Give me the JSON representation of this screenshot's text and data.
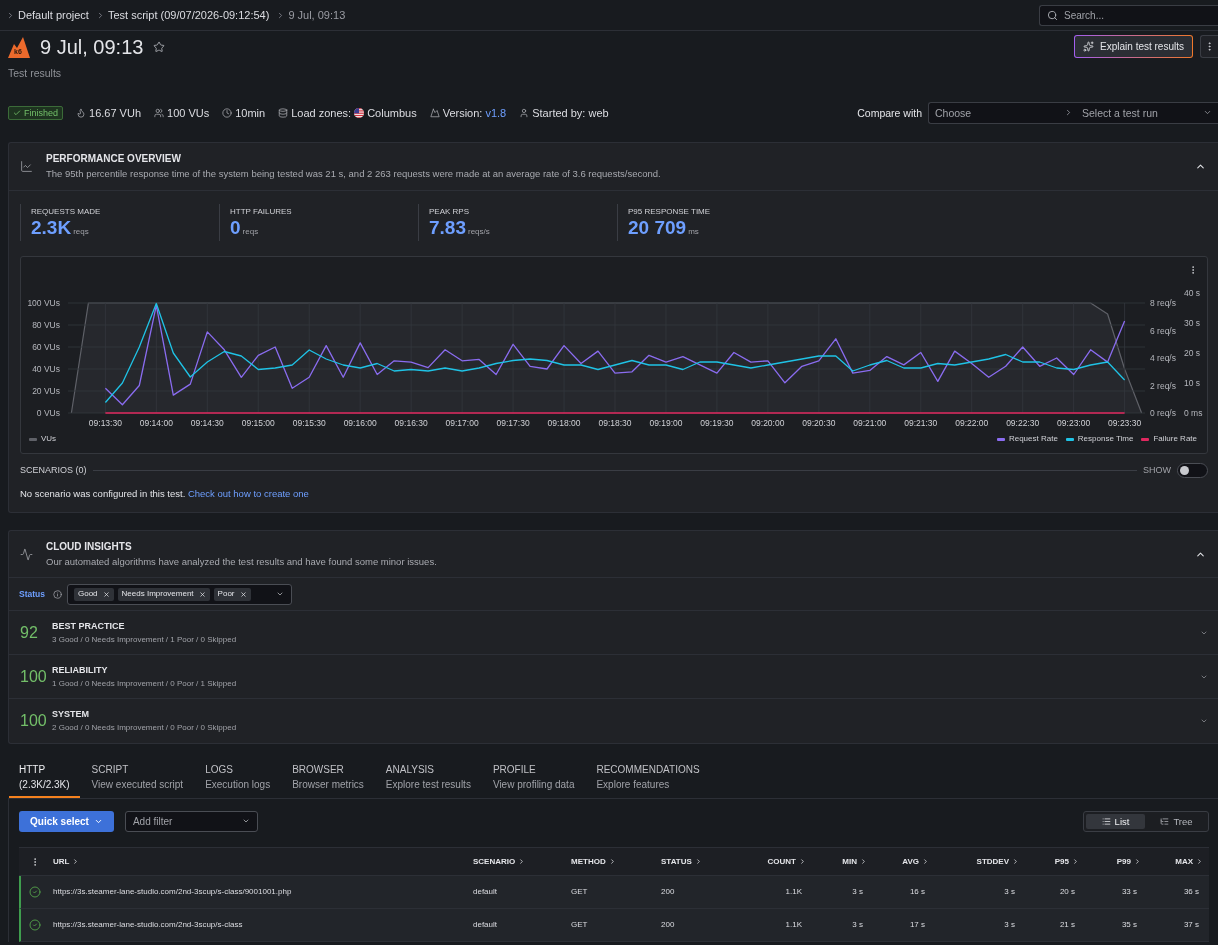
{
  "breadcrumb": [
    {
      "label": "Default project",
      "current": false
    },
    {
      "label": "Test script (09/07/2026-09:12:54)",
      "current": false
    },
    {
      "label": "9 Jul, 09:13",
      "current": true
    }
  ],
  "search": {
    "placeholder": "Search..."
  },
  "header": {
    "logo": "k6",
    "title": "9 Jul, 09:13",
    "starred": false,
    "subtitle": "Test results",
    "explain_button": "Explain test results"
  },
  "run_info": {
    "status": "Finished",
    "items": [
      {
        "kind": "vuh",
        "value": "16.67 VUh"
      },
      {
        "kind": "vus",
        "value": "100 VUs"
      },
      {
        "kind": "duration",
        "value": "10min"
      },
      {
        "kind": "zones",
        "label": "Load zones:",
        "value": "Columbus"
      },
      {
        "kind": "version",
        "label": "Version:",
        "value": "v1.8"
      },
      {
        "kind": "user",
        "value": "Started by: web"
      }
    ]
  },
  "compare": {
    "label": "Compare with",
    "project_placeholder": "Choose",
    "run_placeholder": "Select a test run"
  },
  "performance": {
    "title": "PERFORMANCE OVERVIEW",
    "description": "The 95th percentile response time of the system being tested was 21 s, and 2 263 requests were made at an average rate of 3.6 requests/second.",
    "expanded": true,
    "stats": [
      {
        "label": "REQUESTS MADE",
        "value": "2.3K",
        "unit": "reqs"
      },
      {
        "label": "HTTP FAILURES",
        "value": "0",
        "unit": "reqs"
      },
      {
        "label": "PEAK RPS",
        "value": "7.83",
        "unit": "reqs/s"
      },
      {
        "label": "P95 RESPONSE TIME",
        "value": "20 709",
        "unit": "ms"
      }
    ],
    "chart_data": {
      "type": "line",
      "grid": true,
      "legend": true,
      "categories": [
        null,
        null,
        "09:13:30",
        null,
        null,
        "09:14:00",
        null,
        null,
        "09:14:30",
        null,
        null,
        "09:15:00",
        null,
        null,
        "09:15:30",
        null,
        null,
        "09:16:00",
        null,
        null,
        "09:16:30",
        null,
        null,
        "09:17:00",
        null,
        null,
        "09:17:30",
        null,
        null,
        "09:18:00",
        null,
        null,
        "09:18:30",
        null,
        null,
        "09:19:00",
        null,
        null,
        "09:19:30",
        null,
        null,
        "09:20:00",
        null,
        null,
        "09:20:30",
        null,
        null,
        "09:21:00",
        null,
        null,
        "09:21:30",
        null,
        null,
        "09:22:00",
        null,
        null,
        "09:22:30",
        null,
        null,
        "09:23:00",
        null,
        null,
        "09:23:30",
        null
      ],
      "ylim": [
        0,
        100
      ],
      "yticks": [
        {
          "value": 0,
          "label": "0 VUs"
        },
        {
          "value": 20,
          "label": "20 VUs"
        },
        {
          "value": 40,
          "label": "40 VUs"
        },
        {
          "value": 60,
          "label": "60 VUs"
        },
        {
          "value": 80,
          "label": "80 VUs"
        },
        {
          "value": 100,
          "label": "100 VUs"
        }
      ],
      "y2lim": [
        0,
        8
      ],
      "y2ticks": [
        {
          "value": 0,
          "label": "0 req/s"
        },
        {
          "value": 2,
          "label": "2 req/s"
        },
        {
          "value": 4,
          "label": "4 req/s"
        },
        {
          "value": 6,
          "label": "6 req/s"
        },
        {
          "value": 8,
          "label": "8 req/s"
        }
      ],
      "y3lim": [
        0,
        40
      ],
      "y3ticks": [
        {
          "value": 0,
          "label": "0 ms"
        },
        {
          "value": 10,
          "label": "10 s"
        },
        {
          "value": 20,
          "label": "20 s"
        },
        {
          "value": 30,
          "label": "30 s"
        },
        {
          "value": 40,
          "label": "40 s"
        }
      ],
      "series": [
        {
          "name": "VUs",
          "color": "#5f6168",
          "axis": "y",
          "values": [
            0,
            100,
            100,
            100,
            100,
            100,
            100,
            100,
            100,
            100,
            100,
            100,
            100,
            100,
            100,
            100,
            100,
            100,
            100,
            100,
            100,
            100,
            100,
            100,
            100,
            100,
            100,
            100,
            100,
            100,
            100,
            100,
            100,
            100,
            100,
            100,
            100,
            100,
            100,
            100,
            100,
            100,
            100,
            100,
            100,
            100,
            100,
            100,
            100,
            100,
            100,
            100,
            100,
            100,
            100,
            100,
            100,
            100,
            100,
            100,
            100,
            90,
            40,
            0
          ]
        },
        {
          "name": "Request Rate",
          "color": "#8a6cf0",
          "axis": "y2",
          "values": [
            null,
            null,
            1.8,
            0.6,
            2.0,
            7.83,
            1.3,
            2.1,
            5.9,
            4.6,
            2.6,
            4.2,
            4.8,
            1.8,
            2.6,
            4.9,
            2.6,
            5.1,
            2.8,
            3.8,
            3.7,
            3.3,
            4.6,
            3.8,
            3.9,
            2.8,
            5.0,
            3.4,
            3.2,
            4.9,
            3.6,
            4.5,
            2.9,
            3.0,
            4.2,
            3.7,
            4.1,
            3.5,
            2.9,
            4.4,
            3.7,
            3.8,
            2.2,
            3.4,
            3.8,
            5.4,
            2.9,
            3.1,
            4.1,
            3.5,
            4.4,
            2.3,
            4.5,
            3.6,
            2.6,
            3.4,
            4.8,
            3.4,
            4.0,
            2.8,
            4.6,
            3.7,
            6.7,
            null
          ]
        },
        {
          "name": "Response Time",
          "color": "#1fc3e6",
          "axis": "y3",
          "values": [
            null,
            null,
            3.5,
            10,
            22,
            36.5,
            20,
            12,
            17,
            20.5,
            19,
            14.5,
            15,
            16,
            21,
            18,
            16,
            15,
            16.5,
            14,
            14.5,
            14,
            15,
            14,
            15,
            16.5,
            17.5,
            18,
            17.5,
            16,
            16,
            14.5,
            16,
            17.5,
            16,
            16,
            14.5,
            17,
            17,
            16,
            15,
            16,
            17,
            18,
            19,
            19,
            14,
            16,
            17.5,
            15,
            15,
            16.5,
            16,
            17,
            18,
            19.5,
            17,
            17,
            15,
            14.5,
            16,
            17,
            11,
            null
          ]
        },
        {
          "name": "Failure Rate",
          "color": "#e0285f",
          "axis": "y2",
          "values": [
            null,
            null,
            0,
            0,
            0,
            0,
            0,
            0,
            0,
            0,
            0,
            0,
            0,
            0,
            0,
            0,
            0,
            0,
            0,
            0,
            0,
            0,
            0,
            0,
            0,
            0,
            0,
            0,
            0,
            0,
            0,
            0,
            0,
            0,
            0,
            0,
            0,
            0,
            0,
            0,
            0,
            0,
            0,
            0,
            0,
            0,
            0,
            0,
            0,
            0,
            0,
            0,
            0,
            0,
            0,
            0,
            0,
            0,
            0,
            0,
            0,
            0,
            0,
            null
          ]
        }
      ]
    },
    "scenarios": {
      "title": "SCENARIOS (0)",
      "toggle_label": "SHOW",
      "shown": false,
      "message": "No scenario was configured in this test.",
      "link": "Check out how to create one"
    }
  },
  "insights": {
    "title": "CLOUD INSIGHTS",
    "description": "Our automated algorithms have analyzed the test results and have found some minor issues.",
    "expanded": true,
    "filter": {
      "label": "Status",
      "chips": [
        "Good",
        "Needs Improvement",
        "Poor"
      ]
    },
    "categories": [
      {
        "score": "92",
        "title": "BEST PRACTICE",
        "summary": "3 Good / 0 Needs Improvement / 1 Poor / 0 Skipped",
        "expanded": false
      },
      {
        "score": "100",
        "title": "RELIABILITY",
        "summary": "1 Good / 0 Needs Improvement / 0 Poor / 1 Skipped",
        "expanded": false
      },
      {
        "score": "100",
        "title": "SYSTEM",
        "summary": "2 Good / 0 Needs Improvement / 0 Poor / 0 Skipped",
        "expanded": false
      }
    ]
  },
  "tabs": [
    {
      "title": "HTTP",
      "subtitle": "(2.3K/2.3K)",
      "selected": true
    },
    {
      "title": "SCRIPT",
      "subtitle": "View executed script",
      "selected": false
    },
    {
      "title": "LOGS",
      "subtitle": "Execution logs",
      "selected": false
    },
    {
      "title": "BROWSER",
      "subtitle": "Browser metrics",
      "selected": false
    },
    {
      "title": "ANALYSIS",
      "subtitle": "Explore test results",
      "selected": false
    },
    {
      "title": "PROFILE",
      "subtitle": "View profiling data",
      "selected": false
    },
    {
      "title": "RECOMMENDATIONS",
      "subtitle": "Explore features",
      "selected": false
    }
  ],
  "toolbar": {
    "quick_select": "Quick select",
    "filter_placeholder": "Add filter",
    "views": [
      {
        "kind": "list",
        "label": "List",
        "selected": true
      },
      {
        "kind": "tree",
        "label": "Tree",
        "selected": false
      }
    ]
  },
  "table": {
    "columns": [
      {
        "label": "URL",
        "numeric": false
      },
      {
        "label": "SCENARIO",
        "numeric": false
      },
      {
        "label": "METHOD",
        "numeric": false
      },
      {
        "label": "STATUS",
        "numeric": false
      },
      {
        "label": "COUNT",
        "numeric": true
      },
      {
        "label": "MIN",
        "numeric": true
      },
      {
        "label": "AVG",
        "numeric": true
      },
      {
        "label": "STDDEV",
        "numeric": true
      },
      {
        "label": "P95",
        "numeric": true
      },
      {
        "label": "P99",
        "numeric": true
      },
      {
        "label": "MAX",
        "numeric": true
      }
    ],
    "rows": [
      {
        "passed": true,
        "cells": [
          "https://3s.steamer-lane-studio.com/2nd-3scup/s-class/9001001.php",
          "default",
          "GET",
          "200",
          "1.1K",
          "3 s",
          "16 s",
          "3 s",
          "20 s",
          "33 s",
          "36 s"
        ]
      },
      {
        "passed": true,
        "cells": [
          "https://3s.steamer-lane-studio.com/2nd-3scup/s-class",
          "default",
          "GET",
          "200",
          "1.1K",
          "3 s",
          "17 s",
          "3 s",
          "21 s",
          "35 s",
          "37 s"
        ]
      }
    ]
  }
}
